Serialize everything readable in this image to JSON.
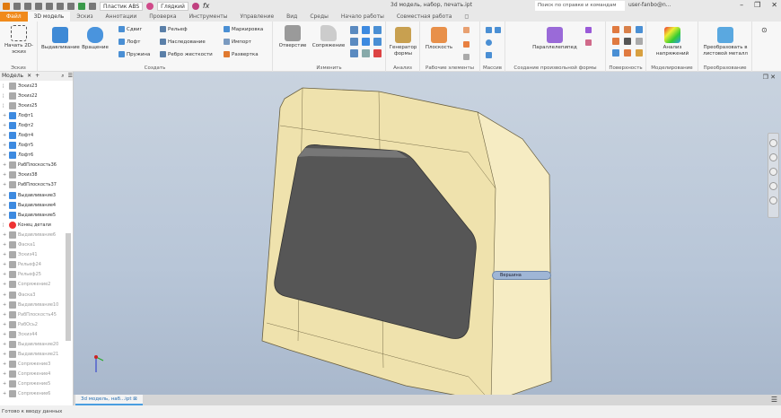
{
  "titlebar": {
    "doc_title": "3d модель, набор, печать.ipt",
    "search_placeholder": "Поиск по справке и командам",
    "user": "user-fanbo@n...",
    "style_select": "Пластик ABS",
    "appearance_select": "Глядкий"
  },
  "tabs": [
    "Файл",
    "3D модель",
    "Эскиз",
    "Аннотации",
    "Проверка",
    "Инструменты",
    "Управление",
    "Вид",
    "Среды",
    "Начало работы",
    "Совместная работа",
    "◻"
  ],
  "ribbon": {
    "sketch": {
      "big": "Начать 2D-эскиз",
      "label": "Эскиз"
    },
    "create": {
      "extrude": "Выдавливание",
      "revolve": "Вращение",
      "sweep": "Сдвиг",
      "loft": "Лофт",
      "coil": "Пружина",
      "emboss": "Рельеф",
      "derive": "Наследование",
      "rib": "Ребро жесткости",
      "unwrap": "Маркировка",
      "import": "Импорт",
      "unfold": "Развертка",
      "label": "Создать"
    },
    "modify": {
      "hole": "Отверстие",
      "fillet": "Сопряжение",
      "label": "Изменить"
    },
    "explore": {
      "big": "Генератор формы",
      "label": "Анализ"
    },
    "work": {
      "plane": "Плоскость",
      "label": "Рабочие элементы"
    },
    "pattern": {
      "label": "Массив"
    },
    "freeform": {
      "big": "Параллелепипед",
      "label": "Создание произвольной формы"
    },
    "surface": {
      "label": "Поверхность"
    },
    "simulation": {
      "big": "Анализ напряжений",
      "label": "Моделирование"
    },
    "convert": {
      "big": "Преобразовать в листовой металл",
      "label": "Преобразование"
    }
  },
  "browser": {
    "title": "Модель",
    "items": [
      {
        "t": "Эскиз23",
        "d": false
      },
      {
        "t": "Эскиз22",
        "d": false
      },
      {
        "t": "Эскиз25",
        "d": false
      },
      {
        "t": "Лофт1",
        "d": false
      },
      {
        "t": "Лофт2",
        "d": false
      },
      {
        "t": "Лофт4",
        "d": false
      },
      {
        "t": "Лофт5",
        "d": false
      },
      {
        "t": "Лофт6",
        "d": false
      },
      {
        "t": "РабПлоскость36",
        "d": false
      },
      {
        "t": "Эскиз38",
        "d": false
      },
      {
        "t": "РабПлоскость37",
        "d": false
      },
      {
        "t": "Выдавливание3",
        "d": false
      },
      {
        "t": "Выдавливание4",
        "d": false
      },
      {
        "t": "Выдавливание5",
        "d": false
      },
      {
        "t": "Конец детали",
        "d": false
      },
      {
        "t": "Выдавливание6",
        "d": true
      },
      {
        "t": "Фаска1",
        "d": true
      },
      {
        "t": "Эскиз41",
        "d": true
      },
      {
        "t": "Рельеф24",
        "d": true
      },
      {
        "t": "Рельеф25",
        "d": true
      },
      {
        "t": "Сопряжение2",
        "d": true
      },
      {
        "t": "Фаска3",
        "d": true
      },
      {
        "t": "Выдавливание10",
        "d": true
      },
      {
        "t": "РабПлоскость45",
        "d": true
      },
      {
        "t": "РабОсь2",
        "d": true
      },
      {
        "t": "Эскиз44",
        "d": true
      },
      {
        "t": "Выдавливание20",
        "d": true
      },
      {
        "t": "Выдавливание21",
        "d": true
      },
      {
        "t": "Сопряжение3",
        "d": true
      },
      {
        "t": "Сопряжение4",
        "d": true
      },
      {
        "t": "Сопряжение5",
        "d": true
      },
      {
        "t": "Сопряжение6",
        "d": true
      }
    ]
  },
  "viewport": {
    "tooltip": "Вершина"
  },
  "doctab": "3d модель, наб...ipt",
  "status": "Готово к вводу данных",
  "colors": {
    "model": "#f2e6b3",
    "insert": "#5a5a5a",
    "accent": "#f08a1c"
  }
}
